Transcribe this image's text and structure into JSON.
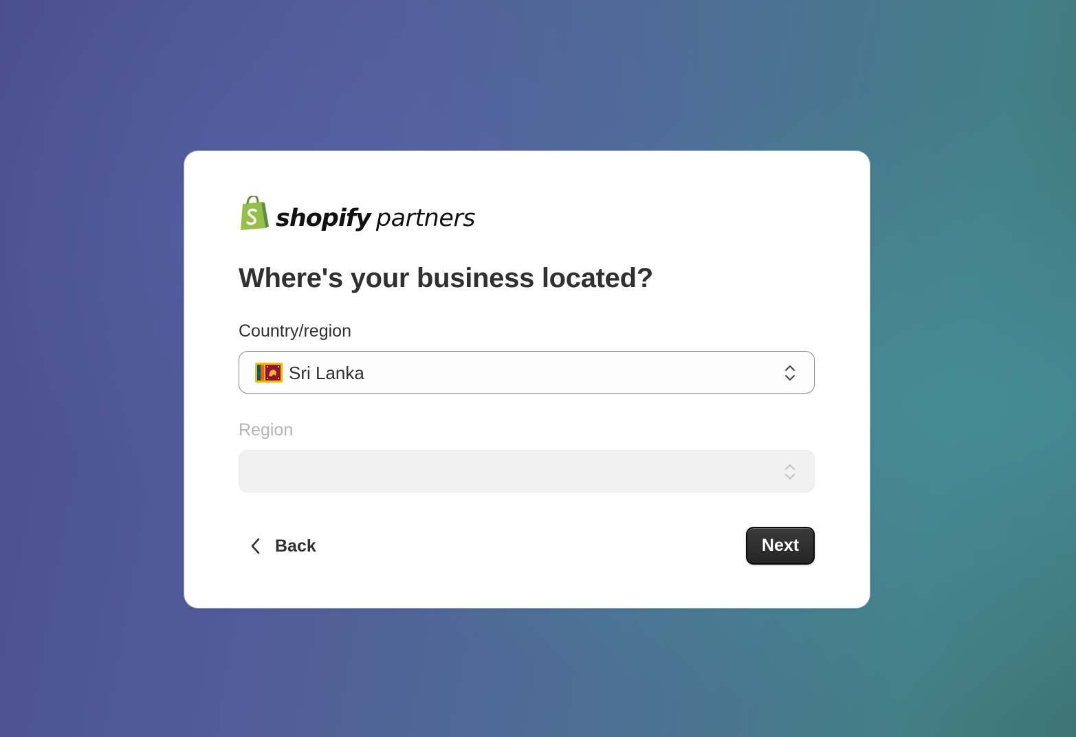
{
  "brand": {
    "logo_icon": "shopify-bag-icon",
    "wordmark_bold": "shopify",
    "wordmark_light": "partners",
    "color": "#95bf47"
  },
  "form": {
    "title": "Where's your business located?",
    "country": {
      "label": "Country/region",
      "value": "Sri Lanka",
      "flag_icon": "sri-lanka-flag-icon",
      "chevron_icon": "select-chevrons-icon"
    },
    "region": {
      "label": "Region",
      "value": "",
      "disabled": true,
      "chevron_icon": "select-chevrons-icon"
    }
  },
  "actions": {
    "back_label": "Back",
    "back_icon": "chevron-left-icon",
    "next_label": "Next"
  }
}
